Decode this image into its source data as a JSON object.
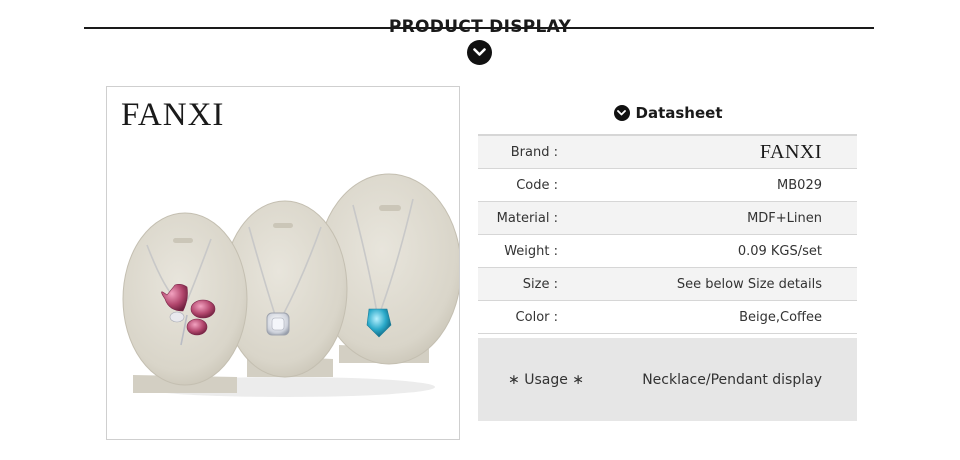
{
  "header": {
    "title": "PRODUCT DISPLAY",
    "chevron_icon": "chevron-down-circle-icon"
  },
  "photo": {
    "brand_logo": "FANXI",
    "colors": {
      "linen": "#dcd8cc",
      "pendant_pink": "#b2466d",
      "pendant_blue": "#2aa9c9"
    }
  },
  "datasheet": {
    "title": "Datasheet",
    "title_icon": "chevron-down-circle-icon",
    "rows": [
      {
        "label": "Brand :",
        "value": "FANXI"
      },
      {
        "label": "Code :",
        "value": "MB029"
      },
      {
        "label": "Material :",
        "value": "MDF+Linen"
      },
      {
        "label": "Weight  :",
        "value": "0.09 KGS/set"
      },
      {
        "label": "Size :",
        "value": "See below Size details"
      },
      {
        "label": "Color :",
        "value": "Beige,Coffee"
      }
    ],
    "usage": {
      "label": "∗ Usage ∗",
      "value": "Necklace/Pendant display"
    }
  }
}
